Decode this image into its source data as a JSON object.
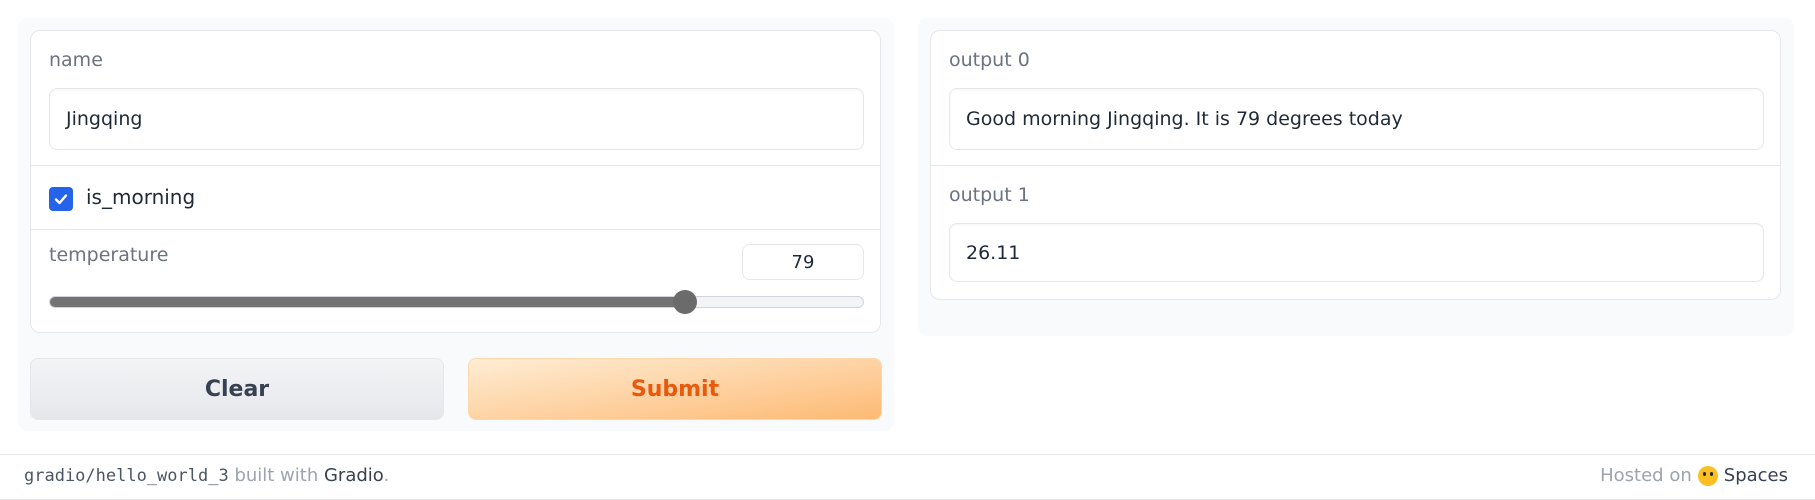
{
  "inputs": {
    "name": {
      "label": "name",
      "value": "Jingqing"
    },
    "is_morning": {
      "label": "is_morning",
      "checked": true
    },
    "temperature": {
      "label": "temperature",
      "value": "79",
      "level_fraction": 0.78
    }
  },
  "buttons": {
    "clear_label": "Clear",
    "submit_label": "Submit"
  },
  "outputs": {
    "output0": {
      "label": "output 0",
      "value": "Good morning Jingqing. It is 79 degrees today"
    },
    "output1": {
      "label": "output 1",
      "value": "26.11"
    }
  },
  "footer": {
    "repo": "gradio/hello_world_3",
    "built_with": "built with",
    "brand": "Gradio",
    "period": ".",
    "hosted_on": "Hosted on",
    "spaces": "Spaces",
    "spaces_icon": "hugging-face-icon"
  },
  "colors": {
    "accent": "#2563eb",
    "submit_text": "#ea580c",
    "submit_bg_from": "#ffedd5",
    "submit_bg_to": "#fdba74"
  }
}
